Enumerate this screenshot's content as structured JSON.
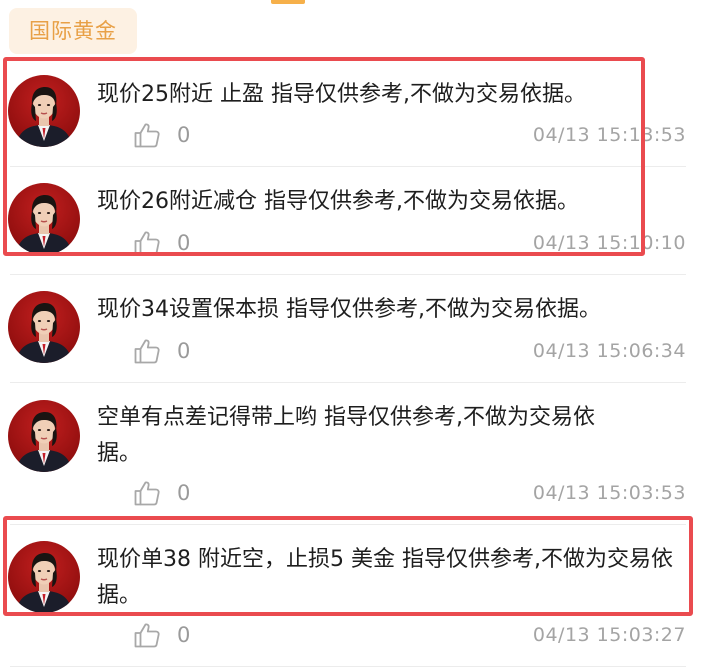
{
  "category_tag": "国际黄金",
  "posts": [
    {
      "text": "现价25附近 止盈 指导仅供参考,不做为交易依据。",
      "likes": "0",
      "time": "04/13 15:13:53"
    },
    {
      "text": "现价26附近减仓 指导仅供参考,不做为交易依据。",
      "likes": "0",
      "time": "04/13 15:10:10"
    },
    {
      "text": "现价34设置保本损 指导仅供参考,不做为交易依据。",
      "likes": "0",
      "time": "04/13 15:06:34"
    },
    {
      "text": "空单有点差记得带上哟 指导仅供参考,不做为交易依据。",
      "likes": "0",
      "time": "04/13 15:03:53"
    },
    {
      "text": "现价单38 附近空，止损5 美金 指导仅供参考,不做为交易依据。",
      "likes": "0",
      "time": "04/13 15:03:27"
    }
  ],
  "colors": {
    "accent": "#e8a046",
    "tag_bg": "#fdf1e3",
    "highlight": "#ea4b4f",
    "muted": "#a4a4a4"
  },
  "icons": {
    "like": "thumbs-up-icon"
  }
}
